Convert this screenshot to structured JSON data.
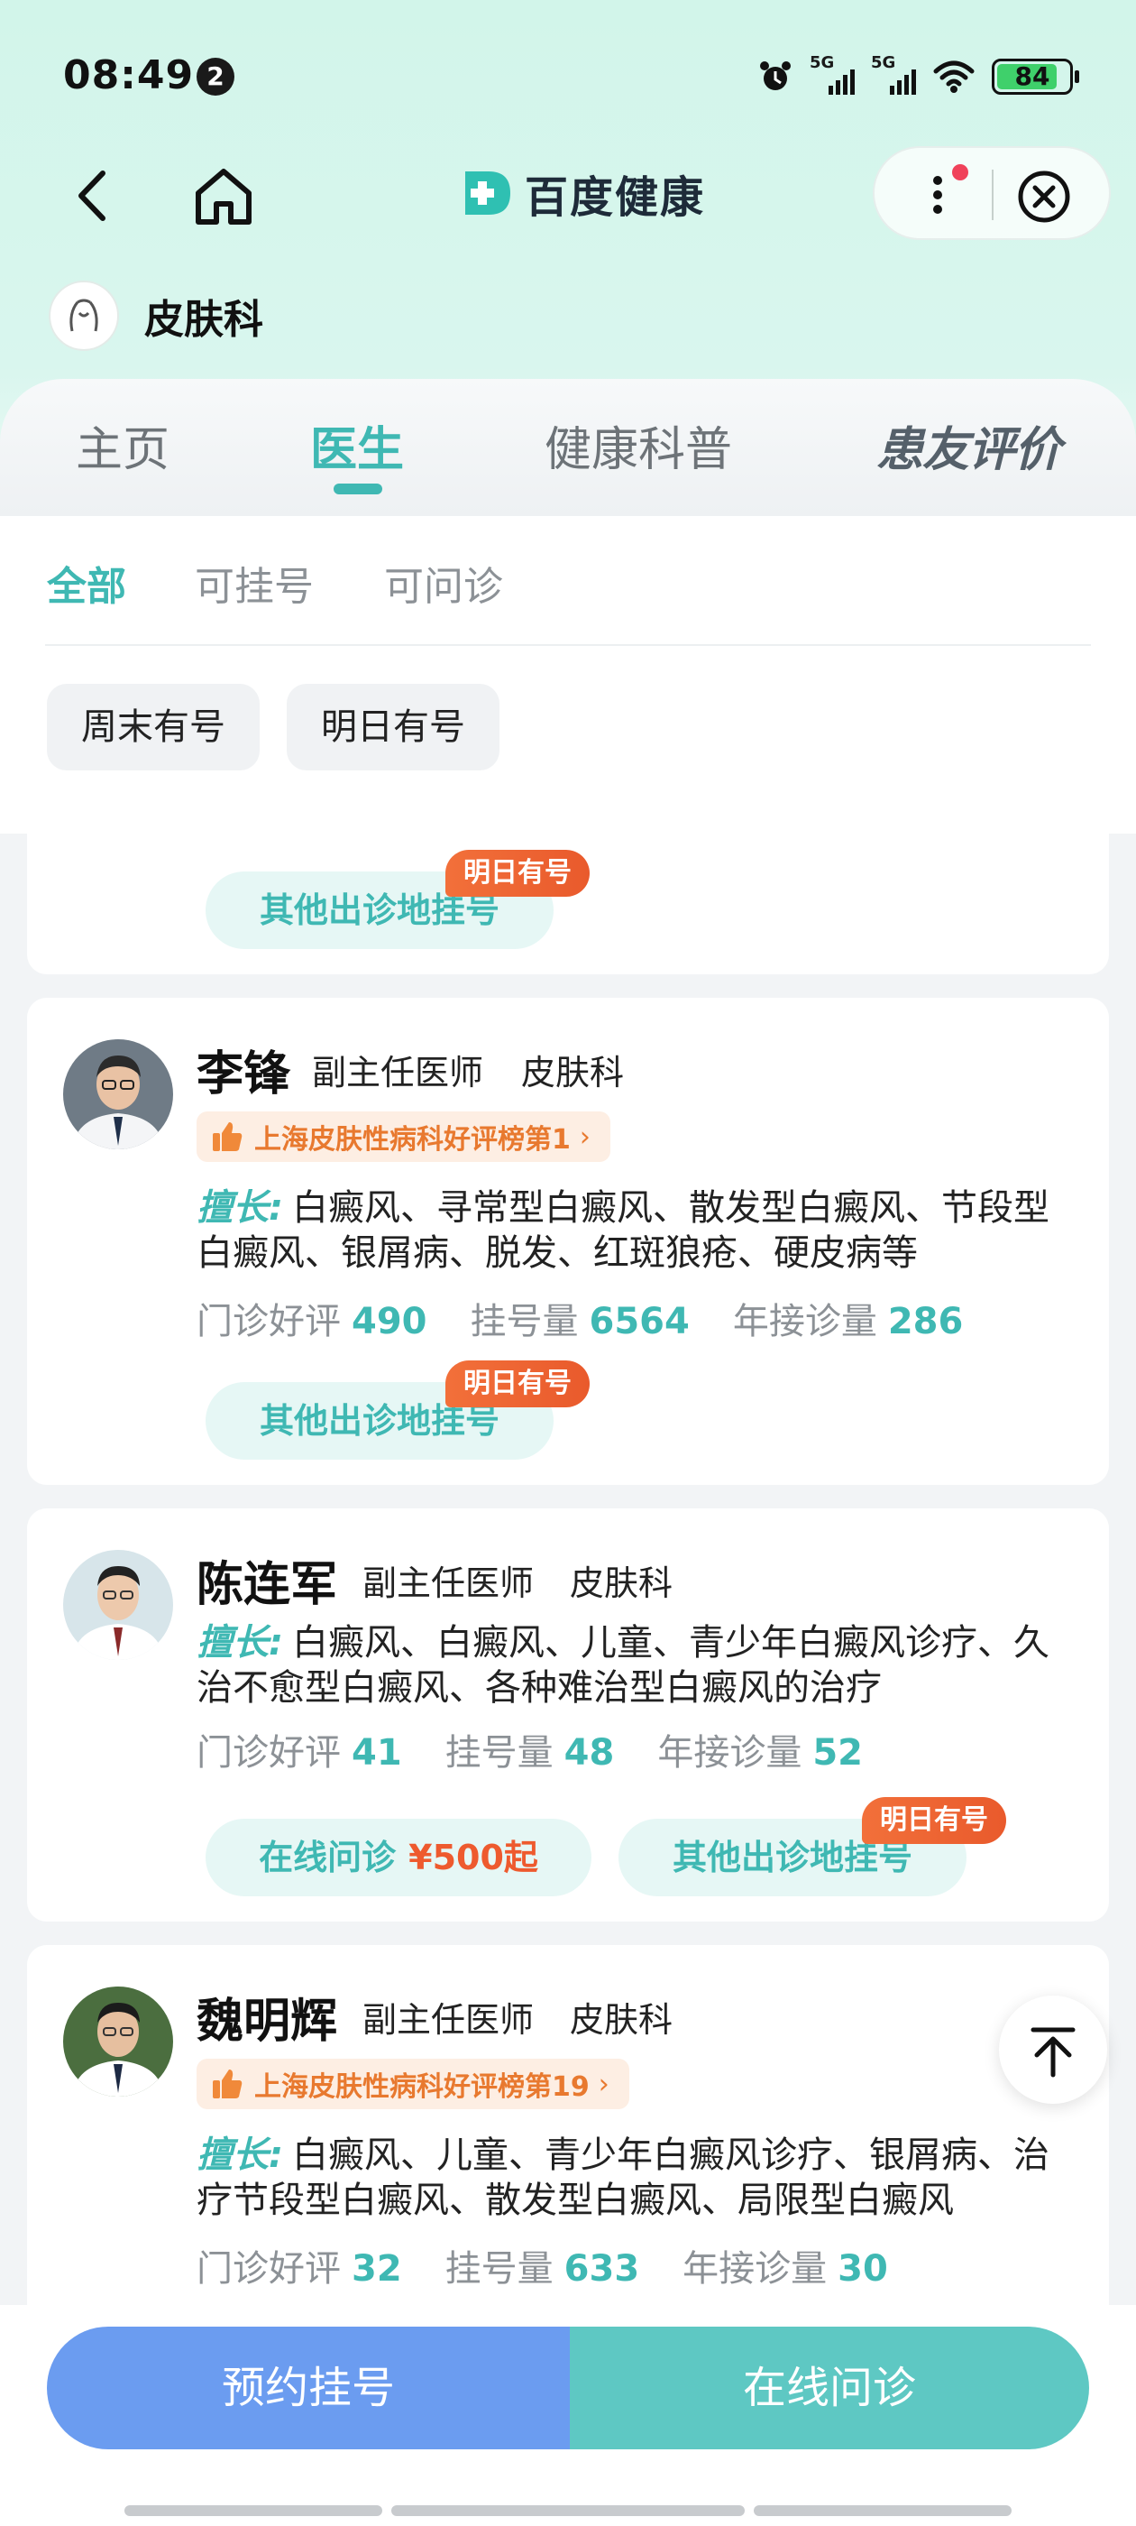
{
  "status_bar": {
    "time": "08:49",
    "notification_count": "2",
    "network1": "5G",
    "network2": "5G",
    "battery": "84"
  },
  "nav": {
    "brand": "百度健康"
  },
  "department": {
    "name": "皮肤科"
  },
  "tabs": [
    {
      "label": "主页"
    },
    {
      "label": "医生"
    },
    {
      "label": "健康科普"
    },
    {
      "label": "患友评价"
    }
  ],
  "filters": {
    "tabs": [
      {
        "label": "全部"
      },
      {
        "label": "可挂号"
      },
      {
        "label": "可问诊"
      }
    ],
    "chips": [
      {
        "label": "周末有号"
      },
      {
        "label": "明日有号"
      }
    ]
  },
  "partial_card": {
    "other_locations": "其他出诊地挂号",
    "tag": "明日有号"
  },
  "doctors": [
    {
      "name": "李锋",
      "title": "副主任医师",
      "dept": "皮肤科",
      "rank": "上海皮肤性病科好评榜第1",
      "specialty_label": "擅长:",
      "specialty": "白癜风、寻常型白癜风、散发型白癜风、节段型白癜风、银屑病、脱发、红斑狼疮、硬皮病等",
      "stats": [
        {
          "label": "门诊好评",
          "value": "490"
        },
        {
          "label": "挂号量",
          "value": "6564"
        },
        {
          "label": "年接诊量",
          "value": "286"
        }
      ],
      "other_locations": "其他出诊地挂号",
      "tag": "明日有号"
    },
    {
      "name": "陈连军",
      "title": "副主任医师",
      "dept": "皮肤科",
      "specialty_label": "擅长:",
      "specialty": "白癜风、白癜风、儿童、青少年白癜风诊疗、久治不愈型白癜风、各种难治型白癜风的治疗",
      "stats": [
        {
          "label": "门诊好评",
          "value": "41"
        },
        {
          "label": "挂号量",
          "value": "48"
        },
        {
          "label": "年接诊量",
          "value": "52"
        }
      ],
      "consult": "在线问诊",
      "price": "¥500起",
      "other_locations": "其他出诊地挂号",
      "tag": "明日有号"
    },
    {
      "name": "魏明辉",
      "title": "副主任医师",
      "dept": "皮肤科",
      "rank": "上海皮肤性病科好评榜第19",
      "specialty_label": "擅长:",
      "specialty": "白癜风、儿童、青少年白癜风诊疗、银屑病、治疗节段型白癜风、散发型白癜风、局限型白癜风",
      "stats": [
        {
          "label": "门诊好评",
          "value": "32"
        },
        {
          "label": "挂号量",
          "value": "633"
        },
        {
          "label": "年接诊量",
          "value": "30"
        }
      ]
    }
  ],
  "bottom": {
    "book": "预约挂号",
    "consult": "在线问诊"
  }
}
